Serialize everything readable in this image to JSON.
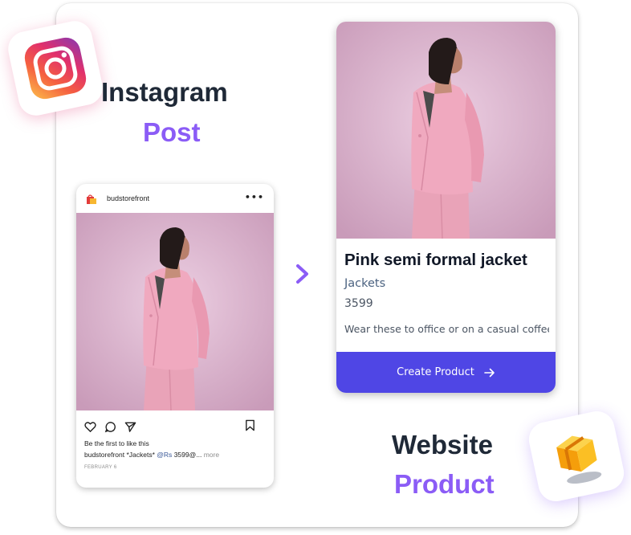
{
  "headings": {
    "instagram": "Instagram",
    "post": "Post",
    "website": "Website",
    "product": "Product"
  },
  "instagram_post": {
    "username": "budstorefront",
    "more_icon": "•••",
    "likes_text": "Be the first to like this",
    "caption_user": "budstorefront",
    "caption_text": "*Jackets*",
    "caption_mention": "@Rs",
    "caption_rest": "3599@...",
    "caption_more": "more",
    "date": "FEBRUARY 6",
    "icons": [
      "heart-icon",
      "comment-icon",
      "share-icon",
      "bookmark-icon"
    ]
  },
  "product_card": {
    "title": "Pink semi formal jacket",
    "category": "Jackets",
    "price": "3599",
    "description": "Wear these to office or on a casual coffee",
    "button_label": "Create Product"
  },
  "colors": {
    "accent_purple": "#8b5cf6",
    "button_indigo": "#4f46e5",
    "heading_dark": "#1f2937",
    "photo_bg": "#dcb4cf",
    "jacket_pink": "#f0a9bf"
  }
}
